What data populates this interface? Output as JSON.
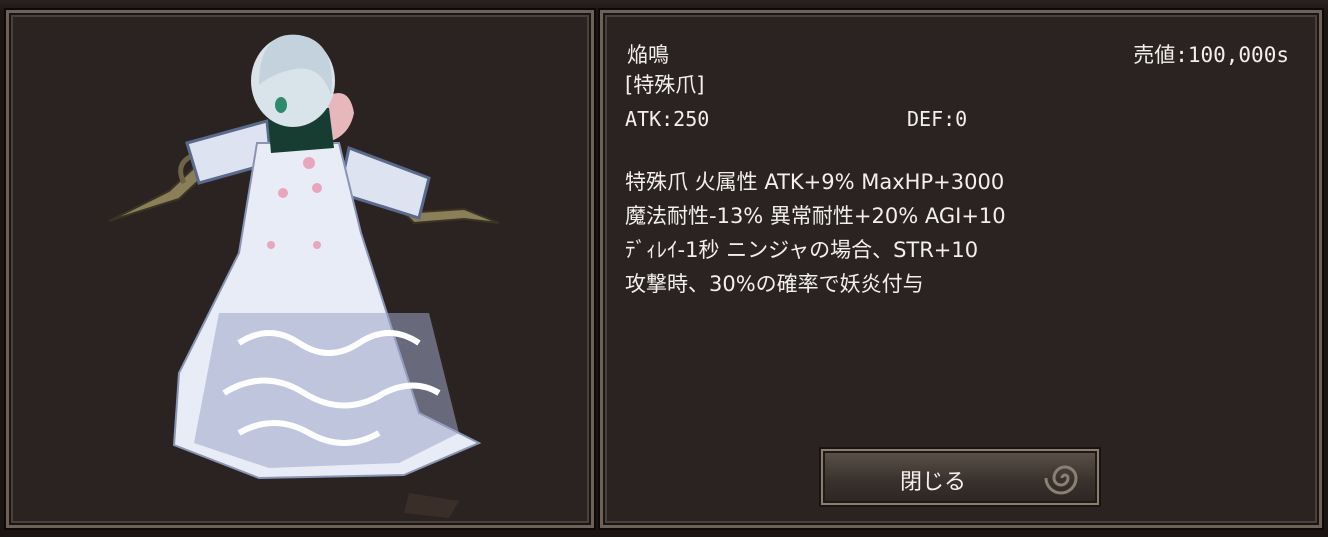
{
  "item": {
    "name": "焔鳴",
    "type": "[特殊爪]",
    "atk": "ATK:250",
    "def": "DEF:0",
    "price": "売値:100,000s",
    "effects": [
      "特殊爪  火属性  ATK+9% MaxHP+3000",
      "魔法耐性-13%  異常耐性+20%  AGI+10",
      "ﾃﾞｨﾚｲ-1秒  ニンジャの場合、STR+10",
      "攻撃時、30%の確率で妖炎付与"
    ]
  },
  "buttons": {
    "close": "閉じる"
  },
  "colors": {
    "panel_bg": "#2b2321",
    "frame": "#6e6258",
    "text": "#f2f0ec"
  },
  "icons": [
    "character-model",
    "swirl-icon"
  ]
}
